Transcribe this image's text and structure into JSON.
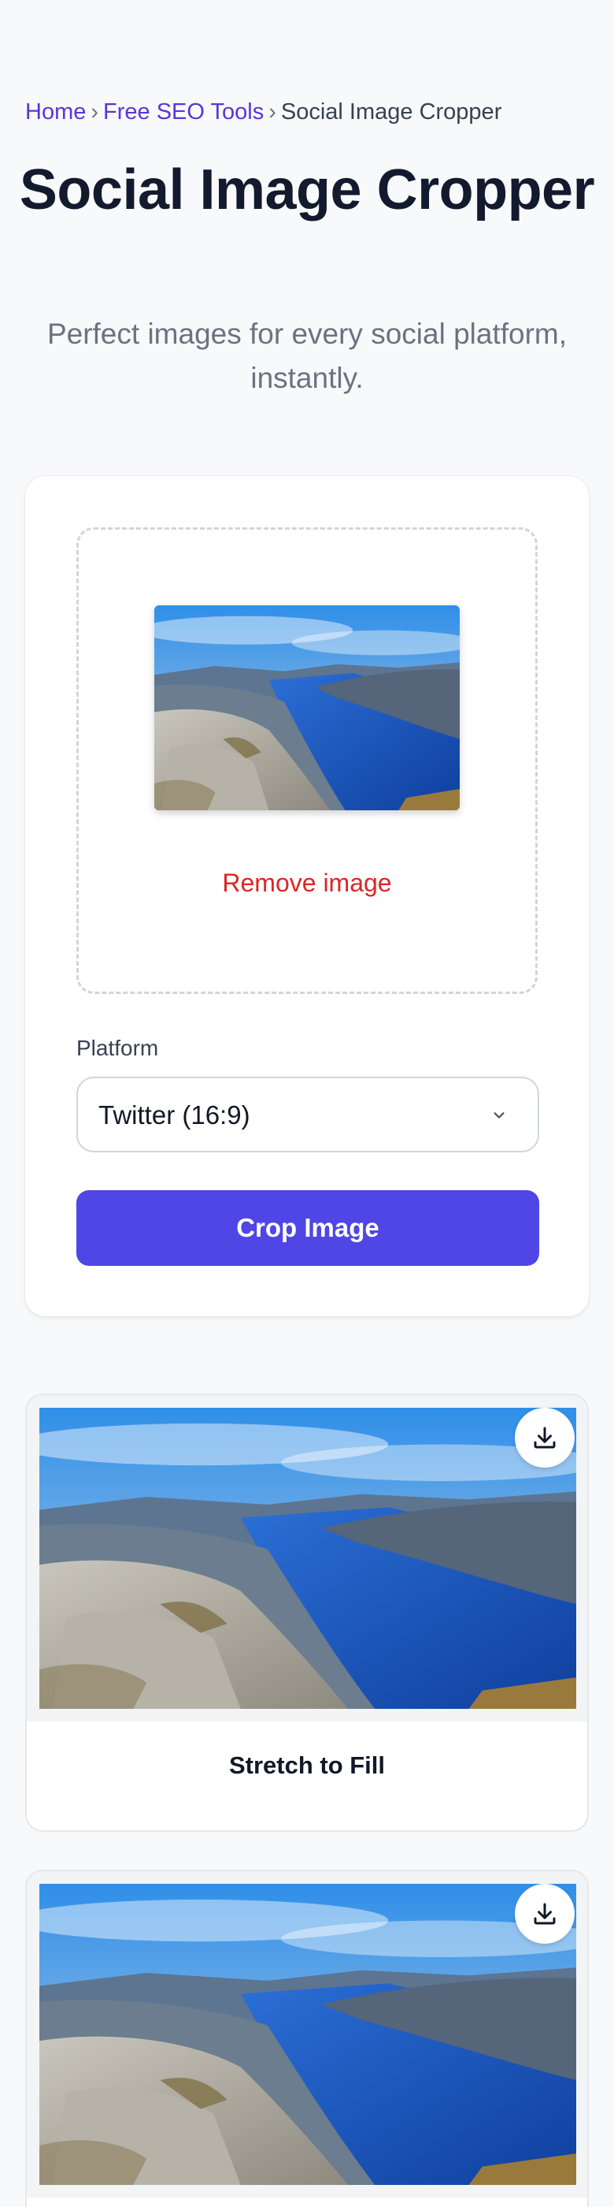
{
  "breadcrumb": {
    "home": "Home",
    "separator": "›",
    "tools": "Free SEO Tools",
    "current": "Social Image Cropper"
  },
  "title": "Social Image Cropper",
  "subtitle": "Perfect images for every social platform, instantly.",
  "upload": {
    "preview_alt": "Uploaded fjord landscape photo",
    "remove_label": "Remove image"
  },
  "platform": {
    "label": "Platform",
    "selected": "Twitter (16:9)"
  },
  "crop_button": "Crop Image",
  "results": [
    {
      "label": "Stretch to Fill",
      "download_icon": "download-icon"
    },
    {
      "label": "",
      "download_icon": "download-icon"
    }
  ],
  "colors": {
    "accent": "#4f46e5",
    "link": "#5b35d5",
    "danger": "#dc2626"
  }
}
